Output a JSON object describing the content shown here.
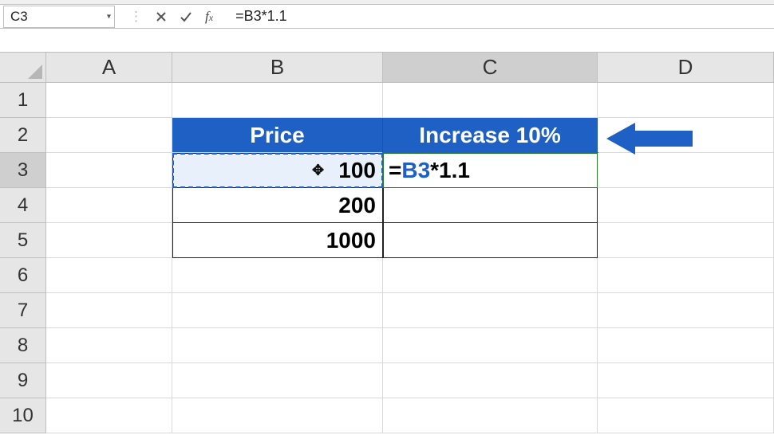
{
  "nameBox": {
    "value": "C3"
  },
  "formulaBar": {
    "text": "=B3*1.1"
  },
  "columns": [
    "A",
    "B",
    "C",
    "D"
  ],
  "activeColumnIndex": 2,
  "rows": [
    "1",
    "2",
    "3",
    "4",
    "5",
    "6",
    "7",
    "8",
    "9",
    "10"
  ],
  "activeRowIndex": 2,
  "table": {
    "headers": {
      "B": "Price",
      "C": "Increase 10%"
    },
    "data": {
      "B3": "100",
      "B4": "200",
      "B5": "1000"
    }
  },
  "activeFormula": {
    "prefix": "=",
    "ref": "B3",
    "suffix": "*1.1"
  },
  "icons": {
    "cancel": "cancel-icon",
    "enter": "enter-icon",
    "fx": "fx-icon"
  }
}
